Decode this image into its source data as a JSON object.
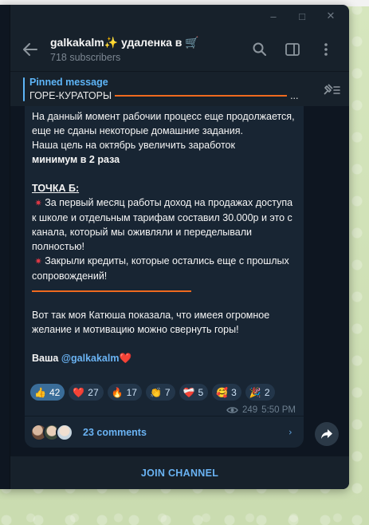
{
  "window": {
    "controls": [
      "–",
      "□",
      "✕"
    ]
  },
  "header": {
    "title": "galkakalm✨ удаленка в 🛒",
    "subtitle": "718 subscribers",
    "icons": [
      "back-arrow-icon",
      "search-icon",
      "sidebar-toggle-icon",
      "more-vertical-icon"
    ]
  },
  "pinned": {
    "label": "Pinned message",
    "preview": "ГОРЕ-КУРАТОРЫ",
    "ellipsis": "...",
    "icon": "unpin-list-icon"
  },
  "message": {
    "lines": {
      "l1": "На данный момент рабочии процесс еще продолжается, еще не сданы некоторые домашние задания.",
      "l2": "Наша цель на октябрь увеличить заработок",
      "l3_bold": "минимум в 2 раза",
      "section_title": "ТОЧКА Б:",
      "bullet1": "За первый месяц работы доход на продажах доступа к школе и отдельным тарифам составил 30.000р и это с канала, который мы оживляли и переделывали полностью!",
      "bullet2": "Закрыли кредиты, которые остались еще с прошлых сопровождений!",
      "l4": "Вот так моя Катюша показала, что имеея огромное желание и мотивацию можно свернуть горы!",
      "sign_prefix": "Ваша ",
      "sign_mention": "@galkakalm",
      "sign_heart": "❤️"
    },
    "bullet_glyph": "✷",
    "reactions": [
      {
        "emoji": "👍",
        "count": "42",
        "active": true
      },
      {
        "emoji": "❤️",
        "count": "27",
        "active": false
      },
      {
        "emoji": "🔥",
        "count": "17",
        "active": false
      },
      {
        "emoji": "👏",
        "count": "7",
        "active": false
      },
      {
        "emoji": "❤️‍🩹",
        "count": "5",
        "active": false
      },
      {
        "emoji": "🥰",
        "count": "3",
        "active": false
      },
      {
        "emoji": "🎉",
        "count": "2",
        "active": false
      }
    ],
    "views": "249",
    "time": "5:50 PM",
    "comments_label": "23 comments"
  },
  "footer": {
    "join_label": "JOIN CHANNEL"
  },
  "colors": {
    "accent": "#6ab3f3",
    "pin_accent": "#5eb5f7",
    "orange_line": "#ef6a1f",
    "bubble": "#182533",
    "chat_bg": "#0e1621",
    "panel_bg": "#17212b"
  }
}
